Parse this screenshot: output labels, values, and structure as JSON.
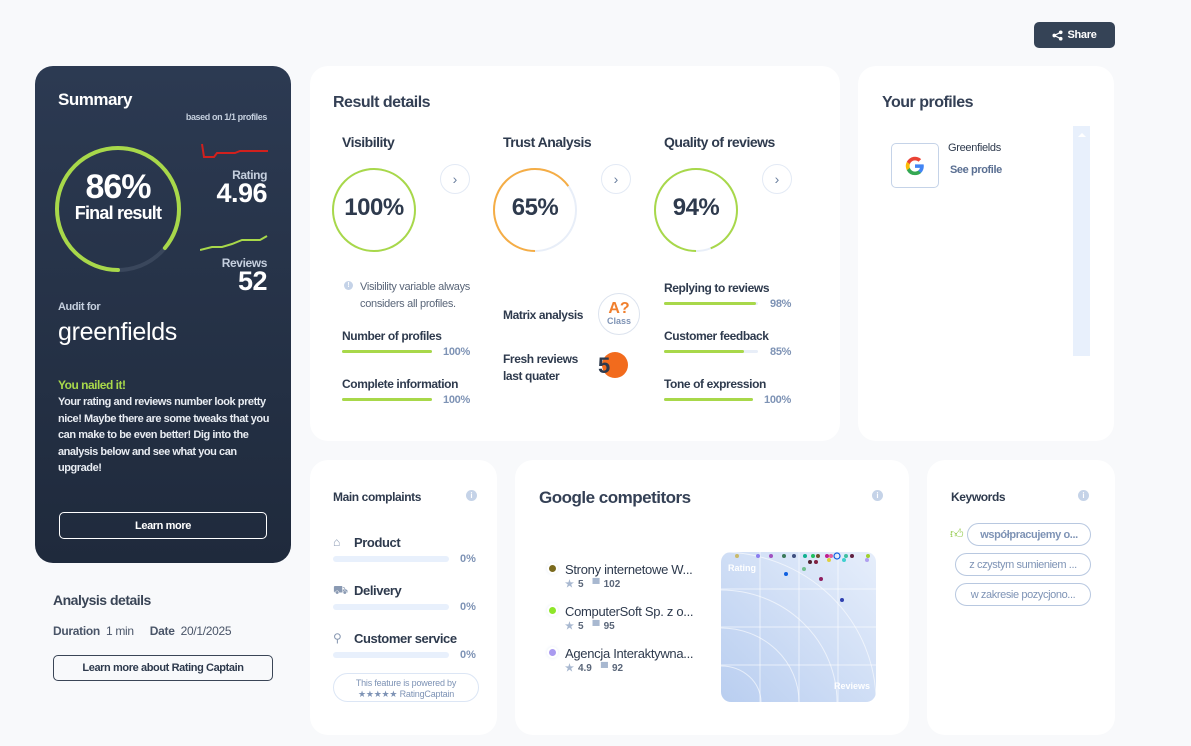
{
  "share": {
    "label": "Share",
    "icon": "share-icon"
  },
  "summary": {
    "title": "Summary",
    "based_on": "based on 1/1 profiles",
    "final_percent": 86,
    "final_percent_text": "86%",
    "final_label": "Final result",
    "rating_label": "Rating",
    "rating_value": "4.96",
    "reviews_label": "Reviews",
    "reviews_value": "52",
    "audit_for_label": "Audit for",
    "audit_name": "greenfields",
    "headline": "You nailed it!",
    "message": "Your rating and reviews number look pretty nice! Maybe there are some tweaks that you can make to be even better! Dig into the analysis below and see what you can upgrade!",
    "learn_more": "Learn more",
    "colors": {
      "accent": "#a8d84a",
      "rating_line": "#d0201d",
      "reviews_line": "#a8d84a"
    }
  },
  "analysis": {
    "title": "Analysis details",
    "duration_label": "Duration",
    "duration_value": "1 min",
    "date_label": "Date",
    "date_value": "20/1/2025",
    "learn_more": "Learn more about Rating Captain"
  },
  "result_details": {
    "title": "Result details",
    "visibility": {
      "title": "Visibility",
      "percent": 100,
      "percent_text": "100%",
      "color": "#a8d84a",
      "note": "Visibility variable always considers all profiles.",
      "bars": [
        {
          "label": "Number of profiles",
          "percent": 100,
          "percent_text": "100%"
        },
        {
          "label": "Complete information",
          "percent": 100,
          "percent_text": "100%"
        }
      ]
    },
    "trust": {
      "title": "Trust Analysis",
      "percent": 65,
      "percent_text": "65%",
      "color": "#f5ad45",
      "matrix_label": "Matrix analysis",
      "matrix_grade": "A?",
      "matrix_class": "Class",
      "fresh_label_1": "Fresh reviews",
      "fresh_label_2": "last quater",
      "fresh_value": "5"
    },
    "quality": {
      "title": "Quality of reviews",
      "percent": 94,
      "percent_text": "94%",
      "color": "#a8d84a",
      "bars": [
        {
          "label": "Replying to reviews",
          "percent": 98,
          "percent_text": "98%"
        },
        {
          "label": "Customer feedback",
          "percent": 85,
          "percent_text": "85%"
        },
        {
          "label": "Tone of expression",
          "percent": 100,
          "percent_text": "100%"
        }
      ]
    }
  },
  "profiles": {
    "title": "Your profiles",
    "items": [
      {
        "name": "Greenfields",
        "link": "See profile",
        "icon": "google-icon"
      }
    ]
  },
  "complaints": {
    "title": "Main complaints",
    "items": [
      {
        "label": "Product",
        "percent": 0,
        "percent_text": "0%",
        "icon": "basket-icon"
      },
      {
        "label": "Delivery",
        "percent": 0,
        "percent_text": "0%",
        "icon": "truck-icon"
      },
      {
        "label": "Customer service",
        "percent": 0,
        "percent_text": "0%",
        "icon": "person-icon"
      }
    ],
    "powered_1": "This feature is powered by",
    "powered_2": "★★★★★ RatingCaptain"
  },
  "competitors": {
    "title": "Google competitors",
    "items": [
      {
        "name": "Strony internetowe W...",
        "rating": "5",
        "reviews": "102",
        "color": "#7a6a1e"
      },
      {
        "name": "ComputerSoft Sp. z o...",
        "rating": "5",
        "reviews": "95",
        "color": "#8ee62a"
      },
      {
        "name": "Agencja Interaktywna...",
        "rating": "4.9",
        "reviews": "92",
        "color": "#a99af0"
      }
    ],
    "scatter_labels": {
      "y": "Rating",
      "x": "Reviews"
    }
  },
  "keywords": {
    "title": "Keywords",
    "items": [
      "współpracujemy o...",
      "z czystym sumieniem ...",
      "w zakresie pozycjono..."
    ]
  }
}
